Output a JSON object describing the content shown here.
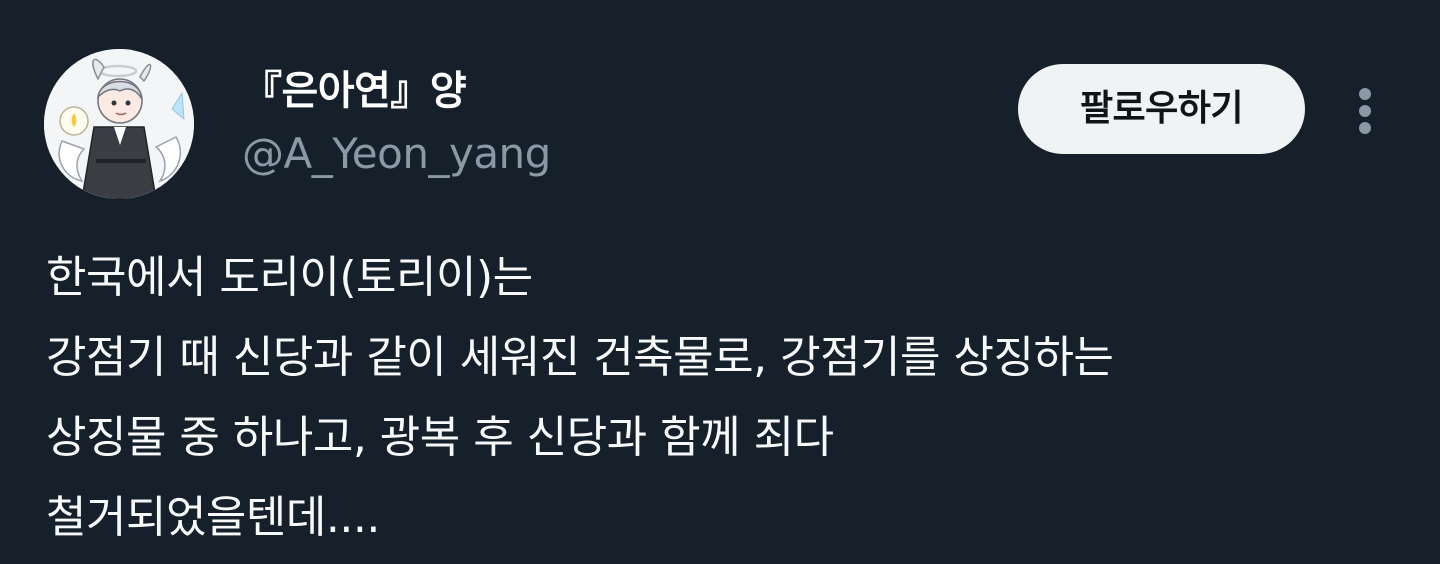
{
  "author": {
    "display_name": "『은아연』양",
    "handle": "@A_Yeon_yang",
    "avatar_icon": "profile-illustration-icon"
  },
  "actions": {
    "follow_label": "팔로우하기",
    "more_icon": "more-options-icon"
  },
  "tweet": {
    "lines": [
      "한국에서 도리이(토리이)는",
      "강점기 때 신당과 같이 세워진 건축물로, 강점기를 상징하는",
      "상징물 중 하나고, 광복 후 신당과 함께 죄다",
      "철거되었을텐데...."
    ]
  },
  "colors": {
    "background": "#15202b",
    "text_primary": "#f7f9f9",
    "text_secondary": "#8b98a5",
    "button_bg": "#eff3f4",
    "button_text": "#0f1419"
  }
}
